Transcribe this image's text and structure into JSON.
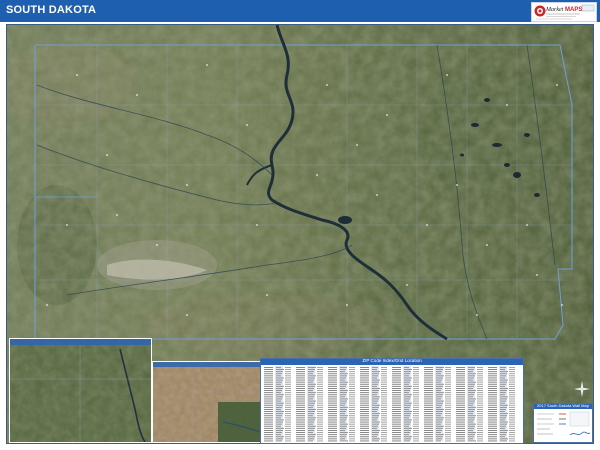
{
  "header": {
    "title": "SOUTH DAKOTA",
    "bar_color": "#1f5fb0",
    "logo_text": "Market MAPS"
  },
  "map": {
    "type": "satellite ZIP code wall map",
    "boundary_color": "#6fa0d8",
    "river": "Missouri River"
  },
  "zip_panel": {
    "title": "ZIP Code Index/Grid Location"
  },
  "legend": {
    "title": "2017 South Dakota Wall Map"
  },
  "compass": {
    "icon": "compass-rose-icon"
  }
}
